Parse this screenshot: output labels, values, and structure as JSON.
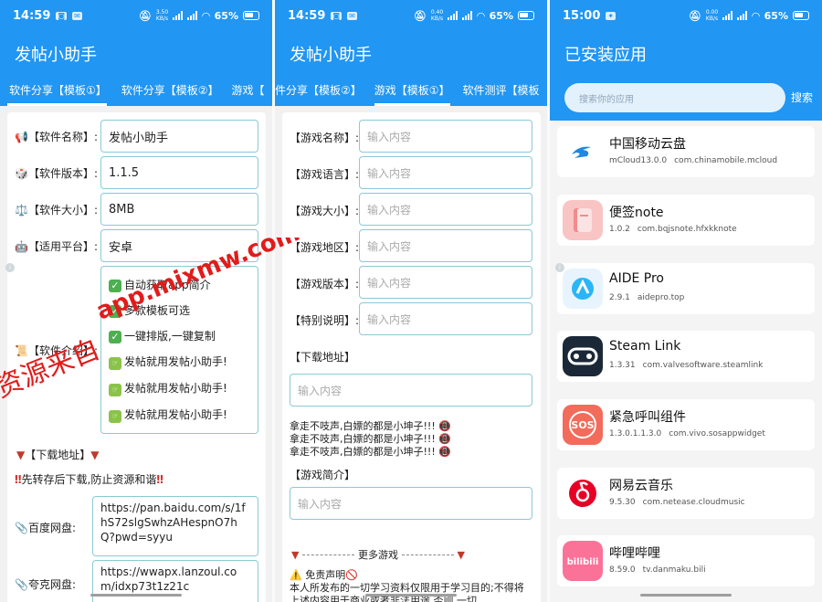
{
  "screen1": {
    "status": {
      "time": "14:59",
      "speed_top": "3.50",
      "speed_bot": "KB/s",
      "battery": "65%"
    },
    "title": "发帖小助手",
    "tabs": [
      "软件分享【模板①】",
      "软件分享【模板②】",
      "游戏【"
    ],
    "fields": [
      {
        "label": "【软件名称】:",
        "value": "发帖小助手"
      },
      {
        "label": "【软件版本】:",
        "value": "1.1.5"
      },
      {
        "label": "【软件大小】:",
        "value": "8MB"
      },
      {
        "label": "【适用平台】:",
        "value": "安卓"
      }
    ],
    "intro_label": "【软件介绍】:",
    "intro_lines": [
      "自动获取app简介",
      "多款模板可选",
      "一键排版,一键复制",
      "发帖就用发帖小助手!",
      "发帖就用发帖小助手!",
      "发帖就用发帖小助手!"
    ],
    "download_header": "【下载地址】",
    "notice": "先转存后下载,防止资源和谐",
    "downloads": [
      {
        "label": "百度网盘:",
        "value": "https://pan.baidu.com/s/1fhS72slgSwhzAHespnO7hQ?pwd=syyu"
      },
      {
        "label": "夸克网盘:",
        "value": "https://wwapx.lanzoul.com/idxp73t1z21c"
      }
    ],
    "watermark_top": "app.mixmw.com",
    "watermark_bottom": "资源来自"
  },
  "screen2": {
    "status": {
      "time": "14:59",
      "speed_top": "0.40",
      "speed_bot": "KB/s",
      "battery": "65%"
    },
    "title": "发帖小助手",
    "tabs": [
      "件分享【模板②】",
      "游戏【模板①】",
      "软件测评【模板"
    ],
    "fields": [
      {
        "label": "【游戏名称】:",
        "placeholder": "输入内容"
      },
      {
        "label": "【游戏语言】:",
        "placeholder": "输入内容"
      },
      {
        "label": "【游戏大小】:",
        "placeholder": "输入内容"
      },
      {
        "label": "【游戏地区】:",
        "placeholder": "输入内容"
      },
      {
        "label": "【游戏版本】:",
        "placeholder": "输入内容"
      },
      {
        "label": "【特别说明】:",
        "placeholder": "输入内容"
      }
    ],
    "download_label": "【下载地址】",
    "download_placeholder": "输入内容",
    "warning_lines": [
      "拿走不吱声,白嫖的都是小坤子!!!",
      "拿走不吱声,白嫖的都是小坤子!!!",
      "拿走不吱声,白嫖的都是小坤子!!!"
    ],
    "intro_label": "【游戏简介】",
    "intro_placeholder": "输入内容",
    "more_games": "更多游戏",
    "disclaimer_title": "免责声明",
    "disclaimer_text": "本人所发布的一切学习资料仅限用于学习目的;不得将上述内容用于商业或者非法用途,否则,一切"
  },
  "screen3": {
    "status": {
      "time": "15:00",
      "speed_top": "0.00",
      "speed_bot": "KB/s",
      "battery": "65%"
    },
    "title": "已安装应用",
    "search_placeholder": "搜索你的应用",
    "search_button": "搜索",
    "apps": [
      {
        "name": "中国移动云盘",
        "version": "mCloud13.0.0",
        "package": "com.chinamobile.mcloud",
        "icon": "cloud-icon",
        "color": "#ffffff"
      },
      {
        "name": "便签note",
        "version": "1.0.2",
        "package": "com.bqjsnote.hfxkknote",
        "icon": "notebook-icon",
        "color": "#f5b8b8"
      },
      {
        "name": "AIDE Pro",
        "version": "2.9.1",
        "package": "aidepro.top",
        "icon": "aide-icon",
        "color": "#e3f2fd"
      },
      {
        "name": "Steam Link",
        "version": "1.3.31",
        "package": "com.valvesoftware.steamlink",
        "icon": "gamepad-icon",
        "color": "#1b2838"
      },
      {
        "name": "紧急呼叫组件",
        "version": "1.3.0.1.1.3.0",
        "package": "com.vivo.sosappwidget",
        "icon": "sos-icon",
        "color": "#f26b5b"
      },
      {
        "name": "网易云音乐",
        "version": "9.5.30",
        "package": "com.netease.cloudmusic",
        "icon": "music-icon",
        "color": "#e60026"
      },
      {
        "name": "哔哩哔哩",
        "version": "8.59.0",
        "package": "tv.danmaku.bili",
        "icon": "bilibili-icon",
        "color": "#fb7299"
      }
    ]
  }
}
